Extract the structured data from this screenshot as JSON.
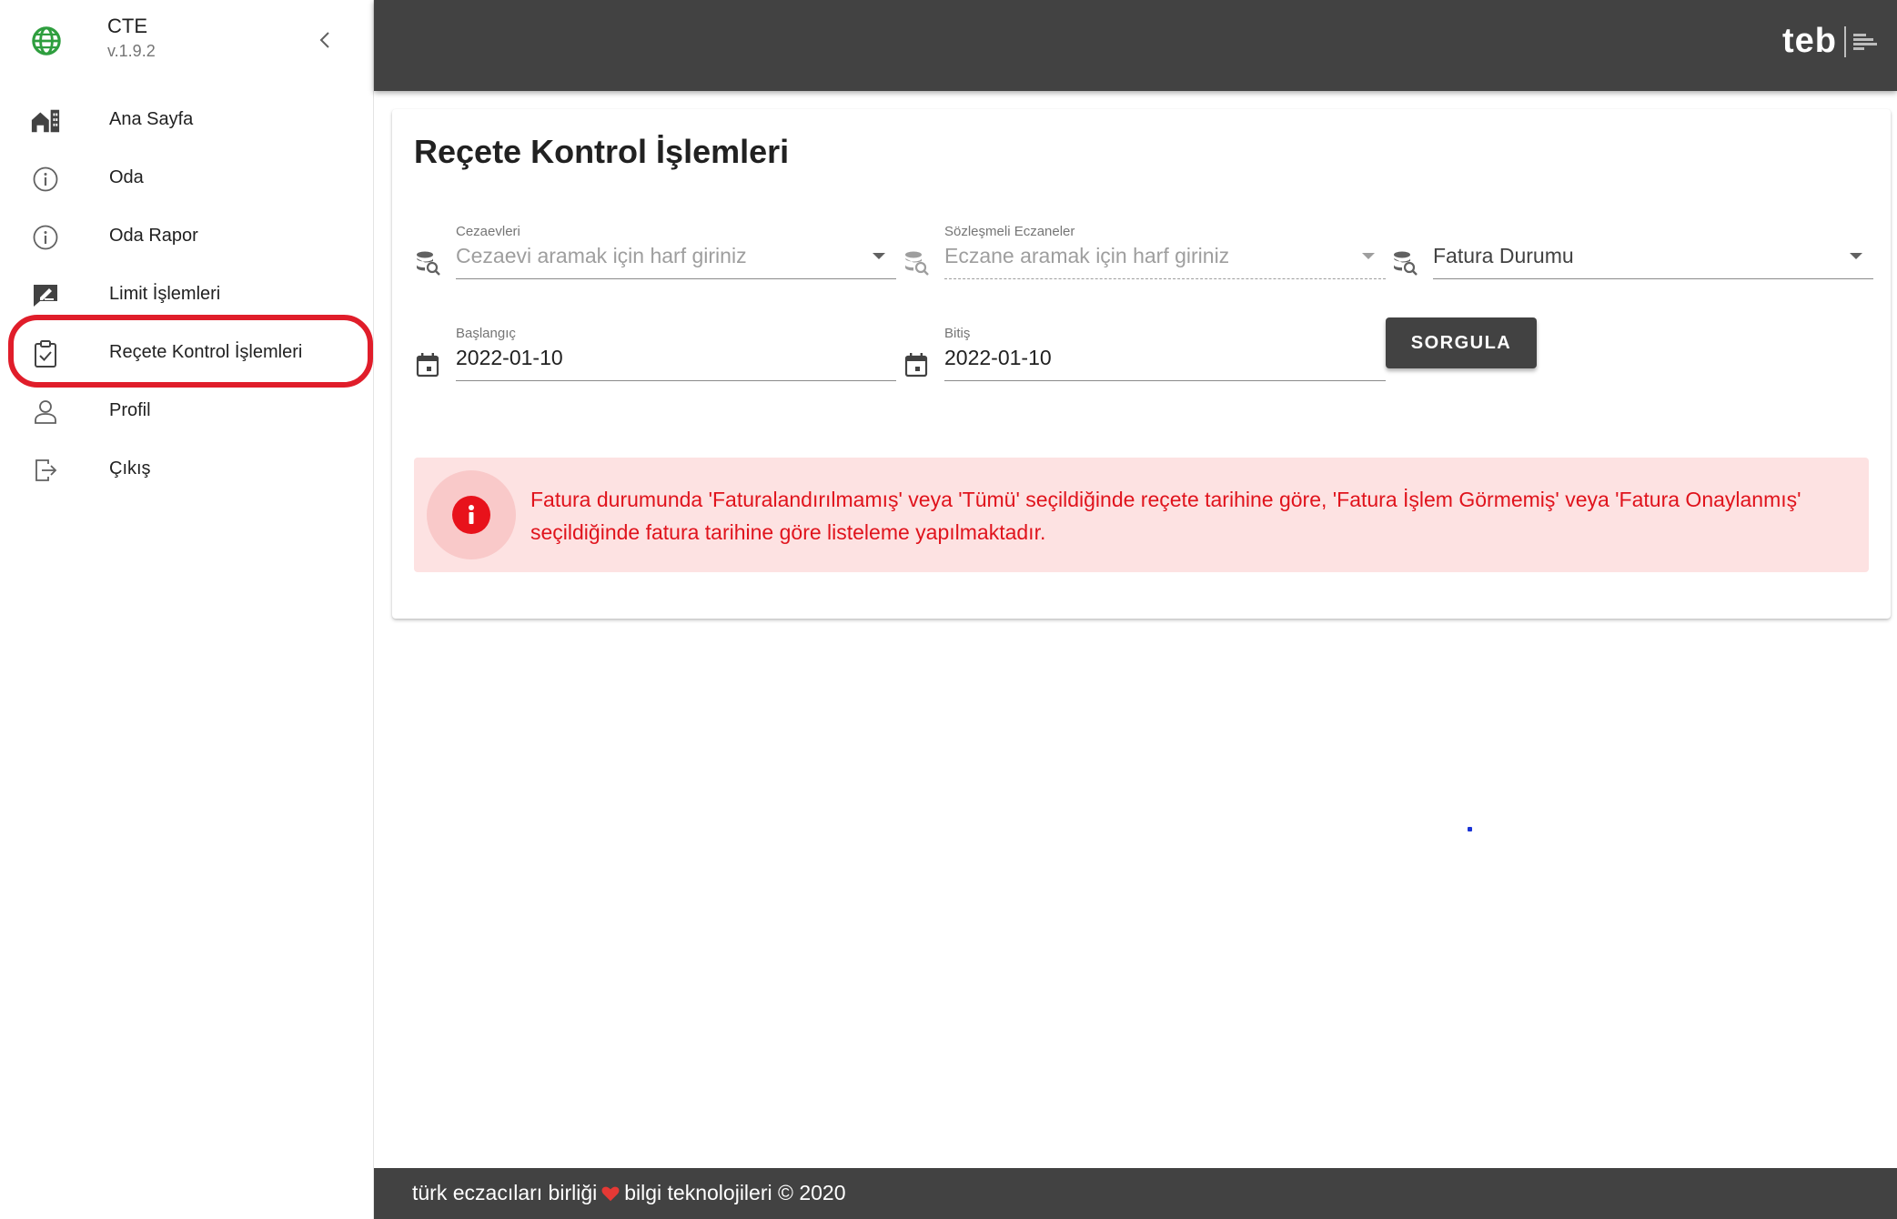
{
  "brand": {
    "title": "CTE",
    "version": "v.1.9.2"
  },
  "sidebar": {
    "items": [
      {
        "label": "Ana Sayfa",
        "icon": "home-city-icon"
      },
      {
        "label": "Oda",
        "icon": "info-icon"
      },
      {
        "label": "Oda Rapor",
        "icon": "info-icon"
      },
      {
        "label": "Limit İşlemleri",
        "icon": "edit-box-icon"
      },
      {
        "label": "Reçete Kontrol İşlemleri",
        "icon": "clipboard-check-icon",
        "active": true
      },
      {
        "label": "Profil",
        "icon": "user-icon"
      },
      {
        "label": "Çıkış",
        "icon": "logout-icon"
      }
    ]
  },
  "topbar": {
    "logo_text": "teb"
  },
  "main": {
    "title": "Reçete Kontrol İşlemleri",
    "filters": {
      "cezaevleri": {
        "label": "Cezaevleri",
        "placeholder": "Cezaevi aramak için harf giriniz"
      },
      "eczaneler": {
        "label": "Sözleşmeli Eczaneler",
        "placeholder": "Eczane aramak için harf giriniz"
      },
      "fatura": {
        "label": "",
        "placeholder": "Fatura Durumu"
      },
      "baslangic": {
        "label": "Başlangıç",
        "value": "2022-01-10"
      },
      "bitis": {
        "label": "Bitiş",
        "value": "2022-01-10"
      }
    },
    "submit_label": "SORGULA",
    "alert_text": "Fatura durumunda 'Faturalandırılmamış' veya 'Tümü' seçildiğinde reçete tarihine göre, 'Fatura İşlem Görmemiş' veya 'Fatura Onaylanmış' seçildiğinde fatura tarihine göre listeleme yapılmaktadır."
  },
  "footer": {
    "text_before": "türk eczacıları birliği",
    "text_after": "bilgi teknolojileri © 2020"
  },
  "colors": {
    "sidebar_highlight": "#e01d2a",
    "alert_bg": "#fde2e2",
    "alert_text": "#e0131c",
    "bar_bg": "#424242"
  }
}
